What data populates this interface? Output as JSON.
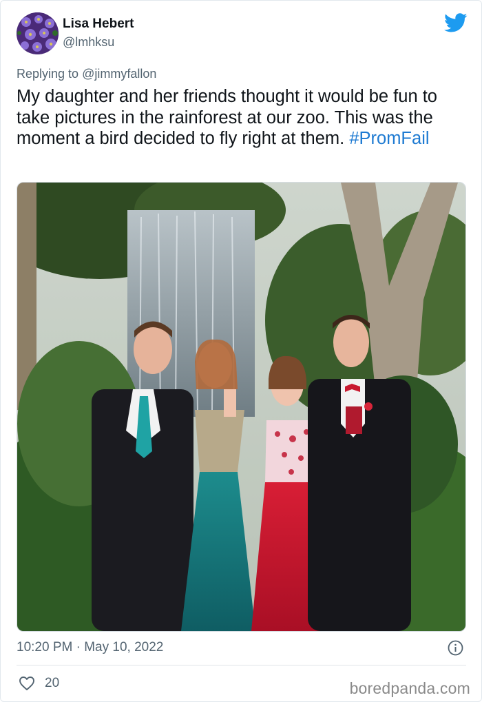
{
  "author": {
    "name": "Lisa Hebert",
    "handle": "@lmhksu"
  },
  "reply": {
    "prefix": "Replying to",
    "to": "@jimmyfallon"
  },
  "tweet": {
    "text": "My daughter and her friends thought it would be fun to take pictures in the rainforest at our zoo. This was the moment a bird decided to fly right at them.",
    "hashtag": "#PromFail"
  },
  "meta": {
    "time": "10:20 PM",
    "separator": "·",
    "date": "May 10, 2022"
  },
  "stats": {
    "likes": "20"
  },
  "watermark": "boredpanda.com",
  "colors": {
    "accent": "#1d9bf0",
    "hashtag": "#1d7ad2",
    "muted": "#536471",
    "text": "#0f1419"
  },
  "icons": {
    "brand": "twitter-bird-icon",
    "info": "info-icon",
    "like": "heart-icon"
  }
}
